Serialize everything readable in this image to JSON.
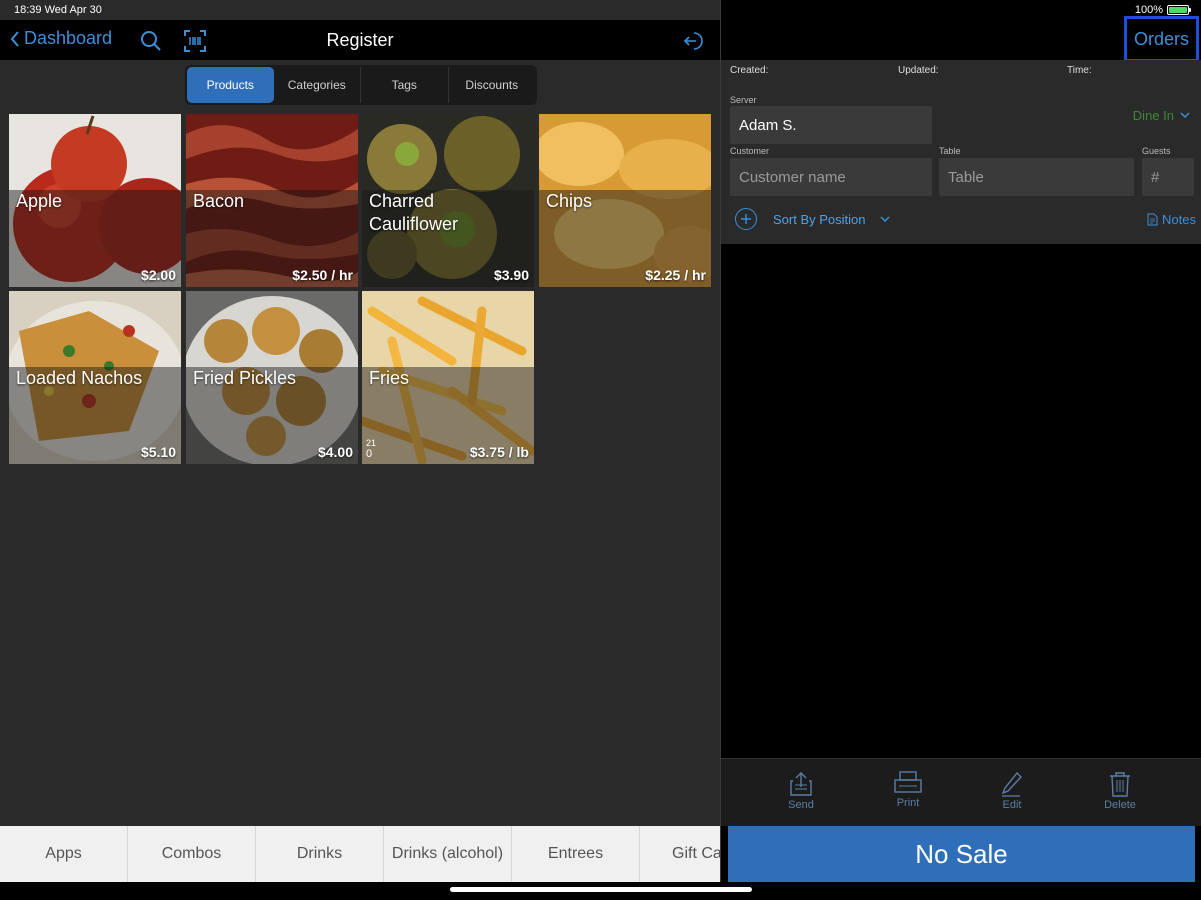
{
  "status": {
    "time": "18:39  Wed Apr 30",
    "battery": "100%"
  },
  "header": {
    "back_label": "Dashboard",
    "title": "Register"
  },
  "segments": [
    {
      "label": "Products",
      "active": true
    },
    {
      "label": "Categories",
      "active": false
    },
    {
      "label": "Tags",
      "active": false
    },
    {
      "label": "Discounts",
      "active": false
    }
  ],
  "products": [
    {
      "name": "Apple",
      "price": "$2.00"
    },
    {
      "name": "Bacon",
      "price": "$2.50 / hr"
    },
    {
      "name": "Charred Cauliflower",
      "price": "$3.90"
    },
    {
      "name": "Chips",
      "price": "$2.25 / hr"
    },
    {
      "name": "Loaded Nachos",
      "price": "$5.10"
    },
    {
      "name": "Fried Pickles",
      "price": "$4.00"
    },
    {
      "name": "Fries",
      "price": "$3.75 / lb",
      "badge_top": "21",
      "badge_bottom": "0"
    }
  ],
  "categories": [
    "Apps",
    "Combos",
    "Drinks",
    "Drinks (alcohol)",
    "Entrees",
    "Gift Ca"
  ],
  "order": {
    "orders_label": "Orders",
    "created_label": "Created:",
    "updated_label": "Updated:",
    "time_label": "Time:",
    "server_label": "Server",
    "server_value": "Adam S.",
    "dine_label": "Dine In",
    "customer_label": "Customer",
    "customer_placeholder": "Customer name",
    "table_label": "Table",
    "table_placeholder": "Table",
    "guests_label": "Guests",
    "guests_placeholder": "#",
    "sort_label": "Sort By Position",
    "notes_label": "Notes"
  },
  "actions": {
    "send": "Send",
    "print": "Print",
    "edit": "Edit",
    "delete": "Delete"
  },
  "no_sale_label": "No Sale",
  "colors": {
    "accent": "#3b8fd9",
    "primary_button": "#2f6fba",
    "dine_in": "#3c8a34",
    "highlight_border": "#1f4fd8"
  }
}
